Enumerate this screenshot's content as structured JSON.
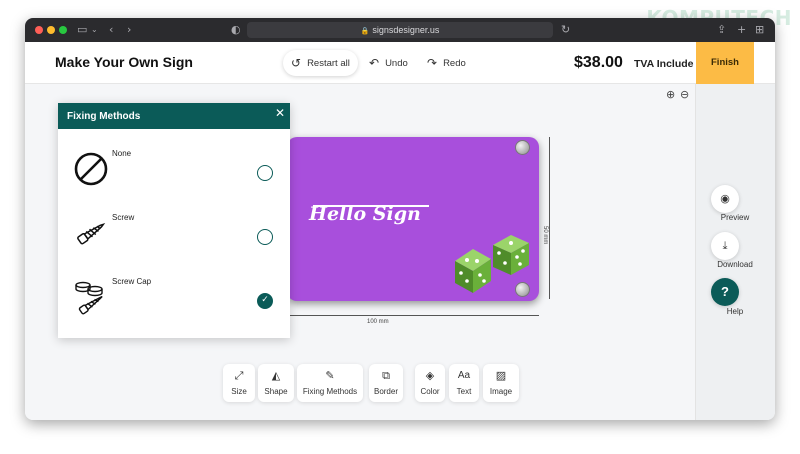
{
  "watermark": "KOMPUTECH",
  "browser": {
    "url": "signsdesigner.us",
    "lock_icon": "lock-icon"
  },
  "header": {
    "title": "Make Your Own Sign",
    "restart_label": "Restart all",
    "undo_label": "Undo",
    "redo_label": "Redo",
    "price": "$38.00",
    "tax_note": "TVA Include",
    "finish_label": "Finish"
  },
  "fixing_panel": {
    "title": "Fixing Methods",
    "options": [
      {
        "label": "None",
        "icon": "no-entry-icon",
        "selected": false
      },
      {
        "label": "Screw",
        "icon": "screw-icon",
        "selected": false
      },
      {
        "label": "Screw Cap",
        "icon": "screw-cap-icon",
        "selected": true
      }
    ]
  },
  "sign": {
    "text": "Hello Sign",
    "background_color": "#a84fdc",
    "width_label": "100 mm",
    "height_label": "50 mm"
  },
  "toolbar": {
    "items": [
      {
        "label": "Size",
        "icon": "size-icon"
      },
      {
        "label": "Shape",
        "icon": "shape-icon"
      },
      {
        "label": "Fixing Methods",
        "icon": "screwdriver-icon"
      },
      {
        "label": "Border",
        "icon": "border-icon"
      },
      {
        "label": "Color",
        "icon": "paint-bucket-icon"
      },
      {
        "label": "Text",
        "icon": "text-icon"
      },
      {
        "label": "Image",
        "icon": "image-icon"
      }
    ]
  },
  "sidebar": {
    "preview_label": "Preview",
    "download_label": "Download",
    "help_label": "Help",
    "help_glyph": "?"
  },
  "colors": {
    "accent": "#0b5b58",
    "finish": "#fcbb45",
    "sign": "#a84fdc"
  }
}
